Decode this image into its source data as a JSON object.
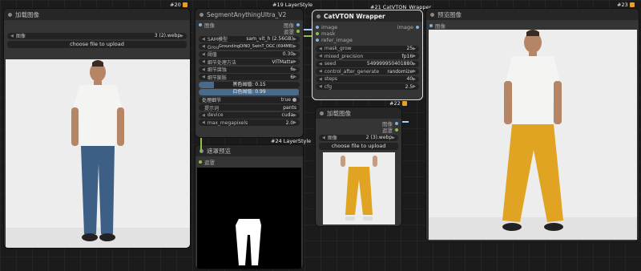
{
  "nodes": {
    "load1": {
      "id": "#20",
      "title": "加载图像",
      "image_value": "3 (2).webp",
      "image_label": "图像",
      "upload_label": "choose file to upload"
    },
    "segment": {
      "id": "#19",
      "type": "LayerStyle",
      "title": "SegmentAnythingUltra_V2",
      "outputs": [
        "图像",
        "遮罩"
      ],
      "inputs": [
        "图像"
      ],
      "widgets": [
        {
          "label": "SAM模型",
          "value": "sam_vit_h (2.56GB)"
        },
        {
          "label": "Grounding DINO模型",
          "value": "GroundingDINO_SwinT_OGC (694MB)"
        },
        {
          "label": "阈值",
          "value": "0.30"
        },
        {
          "label": "细节处理方法",
          "value": "VITMatte"
        },
        {
          "label": "细节腐蚀",
          "value": "6"
        },
        {
          "label": "细节膨胀",
          "value": "6"
        }
      ],
      "black_point": "黑色阈值: 0.15",
      "black_value": 0.15,
      "white_point": "白色阈值: 0.99",
      "white_value": 0.99,
      "toggle_label": "处理细节",
      "toggle_value": "true",
      "rows": [
        {
          "label": "提示词",
          "value": "pants"
        },
        {
          "label": "device",
          "value": "cuda"
        },
        {
          "label": "max_megapixels",
          "value": "2.0"
        }
      ]
    },
    "preview_mask": {
      "id": "#24",
      "type": "LayerStyle",
      "title": "遮罩预览",
      "input": "遮罩"
    },
    "catvton": {
      "id": "#21",
      "type": "CatVTON_Wrapper",
      "title": "CatVTON Wrapper",
      "inputs": [
        "image",
        "mask",
        "refer_image"
      ],
      "output": "image",
      "widgets": [
        {
          "label": "mask_grow",
          "value": "25"
        },
        {
          "label": "mixed_precision",
          "value": "fp16"
        },
        {
          "label": "seed",
          "value": "549999950401880"
        },
        {
          "label": "control_after_generate",
          "value": "randomize"
        },
        {
          "label": "steps",
          "value": "40"
        },
        {
          "label": "cfg",
          "value": "2.5"
        }
      ]
    },
    "load2": {
      "id": "#22",
      "title": "加载图像",
      "outputs": [
        "图像",
        "遮罩"
      ],
      "image_label": "图像",
      "image_value": "2 (3).webp",
      "upload_label": "choose file to upload"
    },
    "preview": {
      "id": "#23",
      "title": "预览图像",
      "input": "图像"
    }
  },
  "colors": {
    "canvas": "#1b1b1b",
    "node": "#353535",
    "title": "#262626",
    "badge_icon": "#e8a020",
    "wire": "#9fd0ff",
    "pants_yellow": "#e0a422",
    "jeans": "#3e5f85"
  }
}
